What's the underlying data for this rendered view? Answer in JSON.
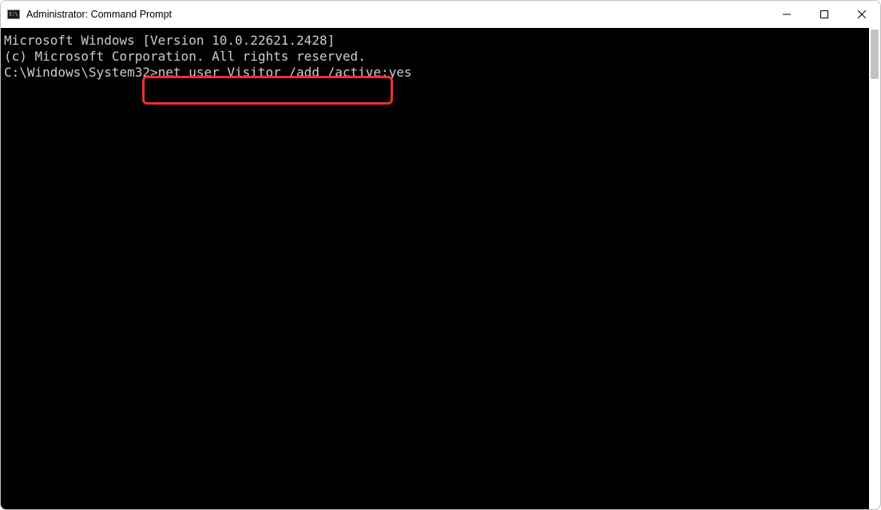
{
  "titlebar": {
    "title": "Administrator: Command Prompt"
  },
  "console": {
    "line1": "Microsoft Windows [Version 10.0.22621.2428]",
    "line2": "(c) Microsoft Corporation. All rights reserved.",
    "blank": "",
    "prompt_path": "C:\\Windows\\System32>",
    "command": "net user Visitor /add /active:yes"
  },
  "annotation": {
    "highlight_color": "#ef2e2c"
  }
}
